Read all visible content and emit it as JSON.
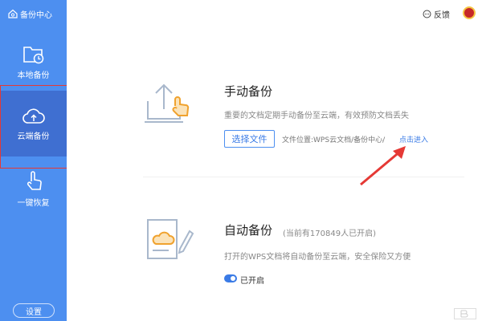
{
  "sidebar": {
    "title": "备份中心",
    "items": [
      {
        "label": "本地备份"
      },
      {
        "label": "云端备份"
      },
      {
        "label": "一键恢复"
      }
    ],
    "settings_label": "设置"
  },
  "topbar": {
    "feedback_label": "反馈"
  },
  "manual_backup": {
    "title": "手动备份",
    "description": "重要的文档定期手动备份至云端，有效预防文档丢失",
    "choose_file_label": "选择文件",
    "file_location": "文件位置:WPS云文档/备份中心/",
    "enter_link": "点击进入"
  },
  "auto_backup": {
    "title": "自动备份",
    "count_text": "(当前有170849人已开启)",
    "description": "打开的WPS文档将自动备份至云端，安全保险又方便",
    "toggle_on": true,
    "toggle_label": "已开启"
  },
  "colors": {
    "sidebar": "#4d8ff0",
    "sidebar_active": "#3f6fd1",
    "accent": "#3a7be6",
    "annotation": "#e53935"
  }
}
